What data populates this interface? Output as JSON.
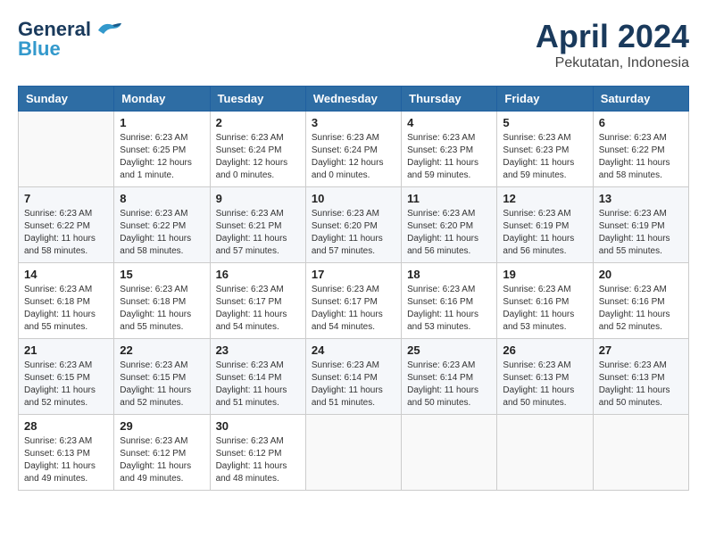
{
  "header": {
    "logo_line1": "General",
    "logo_line2": "Blue",
    "title": "April 2024",
    "subtitle": "Pekutatan, Indonesia"
  },
  "days_of_week": [
    "Sunday",
    "Monday",
    "Tuesday",
    "Wednesday",
    "Thursday",
    "Friday",
    "Saturday"
  ],
  "weeks": [
    [
      {
        "day": "",
        "sunrise": "",
        "sunset": "",
        "daylight": ""
      },
      {
        "day": "1",
        "sunrise": "Sunrise: 6:23 AM",
        "sunset": "Sunset: 6:25 PM",
        "daylight": "Daylight: 12 hours and 1 minute."
      },
      {
        "day": "2",
        "sunrise": "Sunrise: 6:23 AM",
        "sunset": "Sunset: 6:24 PM",
        "daylight": "Daylight: 12 hours and 0 minutes."
      },
      {
        "day": "3",
        "sunrise": "Sunrise: 6:23 AM",
        "sunset": "Sunset: 6:24 PM",
        "daylight": "Daylight: 12 hours and 0 minutes."
      },
      {
        "day": "4",
        "sunrise": "Sunrise: 6:23 AM",
        "sunset": "Sunset: 6:23 PM",
        "daylight": "Daylight: 11 hours and 59 minutes."
      },
      {
        "day": "5",
        "sunrise": "Sunrise: 6:23 AM",
        "sunset": "Sunset: 6:23 PM",
        "daylight": "Daylight: 11 hours and 59 minutes."
      },
      {
        "day": "6",
        "sunrise": "Sunrise: 6:23 AM",
        "sunset": "Sunset: 6:22 PM",
        "daylight": "Daylight: 11 hours and 58 minutes."
      }
    ],
    [
      {
        "day": "7",
        "sunrise": "Sunrise: 6:23 AM",
        "sunset": "Sunset: 6:22 PM",
        "daylight": "Daylight: 11 hours and 58 minutes."
      },
      {
        "day": "8",
        "sunrise": "Sunrise: 6:23 AM",
        "sunset": "Sunset: 6:22 PM",
        "daylight": "Daylight: 11 hours and 58 minutes."
      },
      {
        "day": "9",
        "sunrise": "Sunrise: 6:23 AM",
        "sunset": "Sunset: 6:21 PM",
        "daylight": "Daylight: 11 hours and 57 minutes."
      },
      {
        "day": "10",
        "sunrise": "Sunrise: 6:23 AM",
        "sunset": "Sunset: 6:20 PM",
        "daylight": "Daylight: 11 hours and 57 minutes."
      },
      {
        "day": "11",
        "sunrise": "Sunrise: 6:23 AM",
        "sunset": "Sunset: 6:20 PM",
        "daylight": "Daylight: 11 hours and 56 minutes."
      },
      {
        "day": "12",
        "sunrise": "Sunrise: 6:23 AM",
        "sunset": "Sunset: 6:19 PM",
        "daylight": "Daylight: 11 hours and 56 minutes."
      },
      {
        "day": "13",
        "sunrise": "Sunrise: 6:23 AM",
        "sunset": "Sunset: 6:19 PM",
        "daylight": "Daylight: 11 hours and 55 minutes."
      }
    ],
    [
      {
        "day": "14",
        "sunrise": "Sunrise: 6:23 AM",
        "sunset": "Sunset: 6:18 PM",
        "daylight": "Daylight: 11 hours and 55 minutes."
      },
      {
        "day": "15",
        "sunrise": "Sunrise: 6:23 AM",
        "sunset": "Sunset: 6:18 PM",
        "daylight": "Daylight: 11 hours and 55 minutes."
      },
      {
        "day": "16",
        "sunrise": "Sunrise: 6:23 AM",
        "sunset": "Sunset: 6:17 PM",
        "daylight": "Daylight: 11 hours and 54 minutes."
      },
      {
        "day": "17",
        "sunrise": "Sunrise: 6:23 AM",
        "sunset": "Sunset: 6:17 PM",
        "daylight": "Daylight: 11 hours and 54 minutes."
      },
      {
        "day": "18",
        "sunrise": "Sunrise: 6:23 AM",
        "sunset": "Sunset: 6:16 PM",
        "daylight": "Daylight: 11 hours and 53 minutes."
      },
      {
        "day": "19",
        "sunrise": "Sunrise: 6:23 AM",
        "sunset": "Sunset: 6:16 PM",
        "daylight": "Daylight: 11 hours and 53 minutes."
      },
      {
        "day": "20",
        "sunrise": "Sunrise: 6:23 AM",
        "sunset": "Sunset: 6:16 PM",
        "daylight": "Daylight: 11 hours and 52 minutes."
      }
    ],
    [
      {
        "day": "21",
        "sunrise": "Sunrise: 6:23 AM",
        "sunset": "Sunset: 6:15 PM",
        "daylight": "Daylight: 11 hours and 52 minutes."
      },
      {
        "day": "22",
        "sunrise": "Sunrise: 6:23 AM",
        "sunset": "Sunset: 6:15 PM",
        "daylight": "Daylight: 11 hours and 52 minutes."
      },
      {
        "day": "23",
        "sunrise": "Sunrise: 6:23 AM",
        "sunset": "Sunset: 6:14 PM",
        "daylight": "Daylight: 11 hours and 51 minutes."
      },
      {
        "day": "24",
        "sunrise": "Sunrise: 6:23 AM",
        "sunset": "Sunset: 6:14 PM",
        "daylight": "Daylight: 11 hours and 51 minutes."
      },
      {
        "day": "25",
        "sunrise": "Sunrise: 6:23 AM",
        "sunset": "Sunset: 6:14 PM",
        "daylight": "Daylight: 11 hours and 50 minutes."
      },
      {
        "day": "26",
        "sunrise": "Sunrise: 6:23 AM",
        "sunset": "Sunset: 6:13 PM",
        "daylight": "Daylight: 11 hours and 50 minutes."
      },
      {
        "day": "27",
        "sunrise": "Sunrise: 6:23 AM",
        "sunset": "Sunset: 6:13 PM",
        "daylight": "Daylight: 11 hours and 50 minutes."
      }
    ],
    [
      {
        "day": "28",
        "sunrise": "Sunrise: 6:23 AM",
        "sunset": "Sunset: 6:13 PM",
        "daylight": "Daylight: 11 hours and 49 minutes."
      },
      {
        "day": "29",
        "sunrise": "Sunrise: 6:23 AM",
        "sunset": "Sunset: 6:12 PM",
        "daylight": "Daylight: 11 hours and 49 minutes."
      },
      {
        "day": "30",
        "sunrise": "Sunrise: 6:23 AM",
        "sunset": "Sunset: 6:12 PM",
        "daylight": "Daylight: 11 hours and 48 minutes."
      },
      {
        "day": "",
        "sunrise": "",
        "sunset": "",
        "daylight": ""
      },
      {
        "day": "",
        "sunrise": "",
        "sunset": "",
        "daylight": ""
      },
      {
        "day": "",
        "sunrise": "",
        "sunset": "",
        "daylight": ""
      },
      {
        "day": "",
        "sunrise": "",
        "sunset": "",
        "daylight": ""
      }
    ]
  ]
}
